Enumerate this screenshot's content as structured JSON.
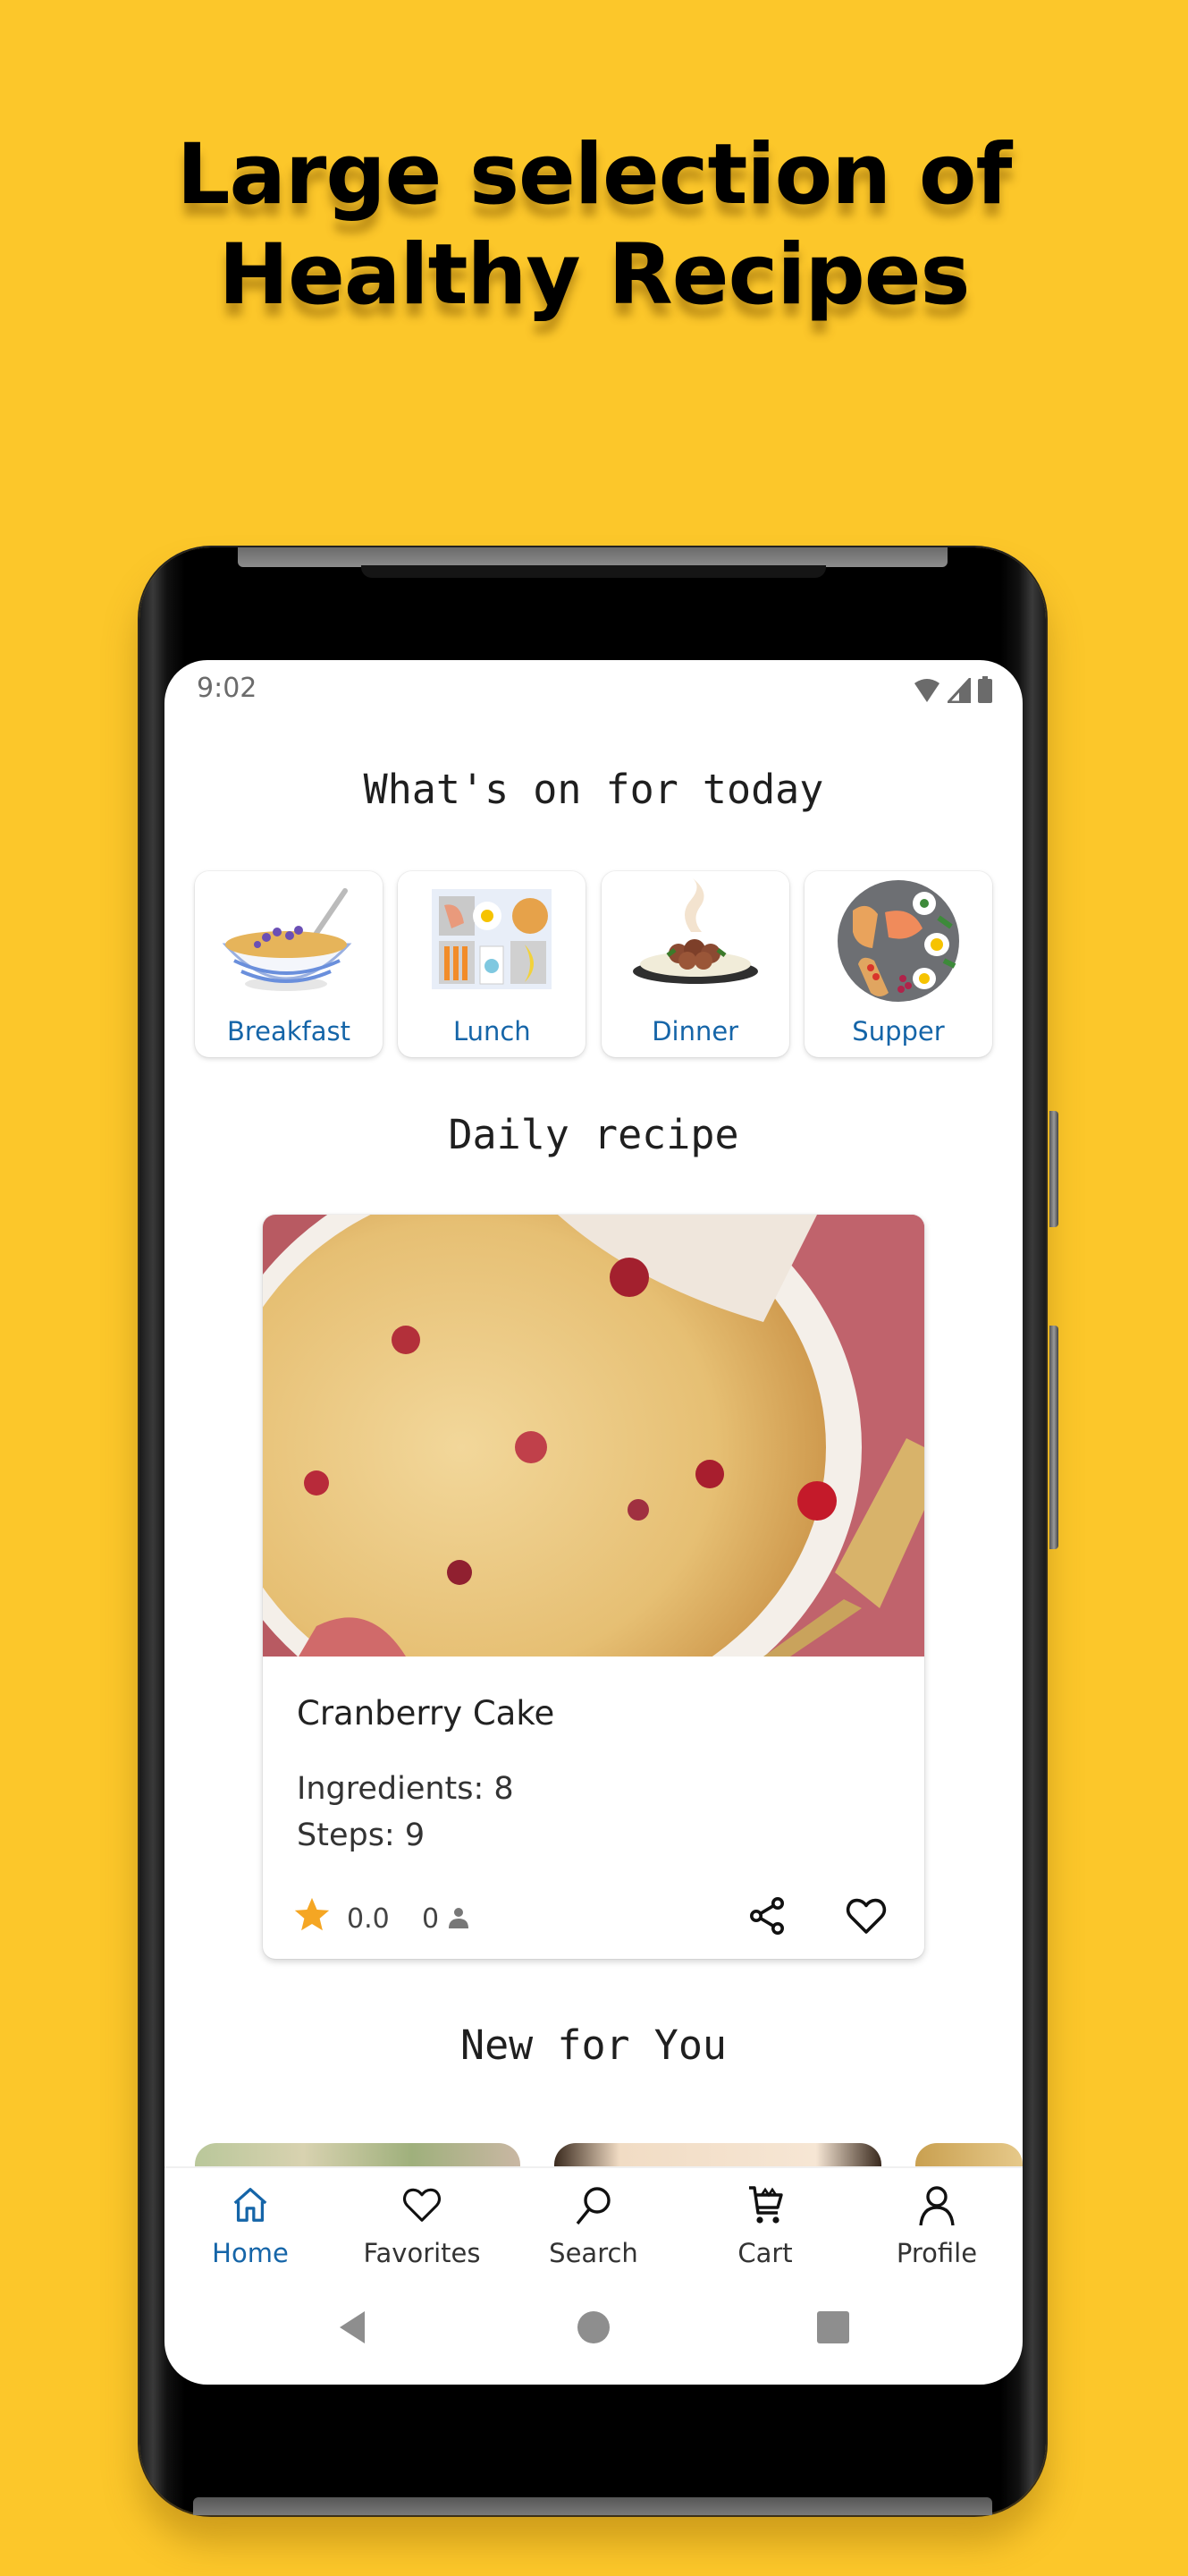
{
  "promo": {
    "headline_line1": "Large selection of",
    "headline_line2": "Healthy Recipes",
    "background_color": "#FCC72A"
  },
  "status_bar": {
    "time": "9:02",
    "icons": [
      "wifi-icon",
      "signal-icon",
      "battery-icon"
    ]
  },
  "home": {
    "categories_title": "What's on for today",
    "categories": [
      {
        "label": "Breakfast",
        "icon": "cereal-bowl-illustration"
      },
      {
        "label": "Lunch",
        "icon": "lunch-tray-illustration"
      },
      {
        "label": "Dinner",
        "icon": "steaming-dinner-plate-illustration"
      },
      {
        "label": "Supper",
        "icon": "supper-platter-illustration"
      }
    ],
    "daily_title": "Daily recipe",
    "daily_recipe": {
      "name": "Cranberry Cake",
      "ingredients_text": "Ingredients: 8",
      "steps_text": "Steps: 9",
      "rating": "0.0",
      "reviews_count": "0",
      "image": "cranberry-cake-photo"
    },
    "new_title": "New for You",
    "new_items": [
      "salad-photo",
      "dish-photo",
      "pastry-photo"
    ]
  },
  "bottom_nav": {
    "items": [
      {
        "label": "Home",
        "icon": "home-icon",
        "active": true
      },
      {
        "label": "Favorites",
        "icon": "heart-icon",
        "active": false
      },
      {
        "label": "Search",
        "icon": "search-icon",
        "active": false
      },
      {
        "label": "Cart",
        "icon": "cart-icon",
        "active": false
      },
      {
        "label": "Profile",
        "icon": "profile-icon",
        "active": false
      }
    ]
  },
  "colors": {
    "accent": "#1565A8",
    "star": "#F5A623",
    "text": "#222222"
  }
}
